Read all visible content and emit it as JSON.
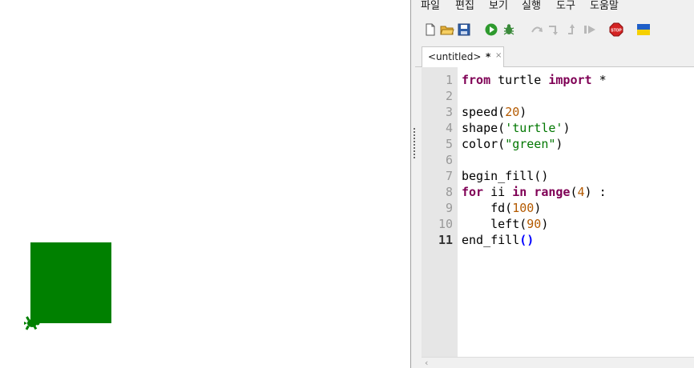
{
  "menu": [
    "파일",
    "편집",
    "보기",
    "실행",
    "도구",
    "도움말"
  ],
  "toolbar": {
    "icons": [
      "new-file-icon",
      "open-file-icon",
      "save-icon",
      "run-icon",
      "debug-icon",
      "step-over-icon",
      "step-into-icon",
      "step-out-icon",
      "resume-icon",
      "stop-icon",
      "ukraine-flag-icon"
    ]
  },
  "tab": {
    "title": "<untitled>",
    "modified": "*",
    "close": "×"
  },
  "editor": {
    "line_numbers": [
      "1",
      "2",
      "3",
      "4",
      "5",
      "6",
      "7",
      "8",
      "9",
      "10",
      "11"
    ],
    "current_line": "11"
  },
  "colors": {
    "fill": "#008000",
    "keyword": "#7f0055",
    "string": "#007700",
    "number": "#b45a00"
  },
  "canvas": {
    "shape": "turtle",
    "color": "green"
  }
}
